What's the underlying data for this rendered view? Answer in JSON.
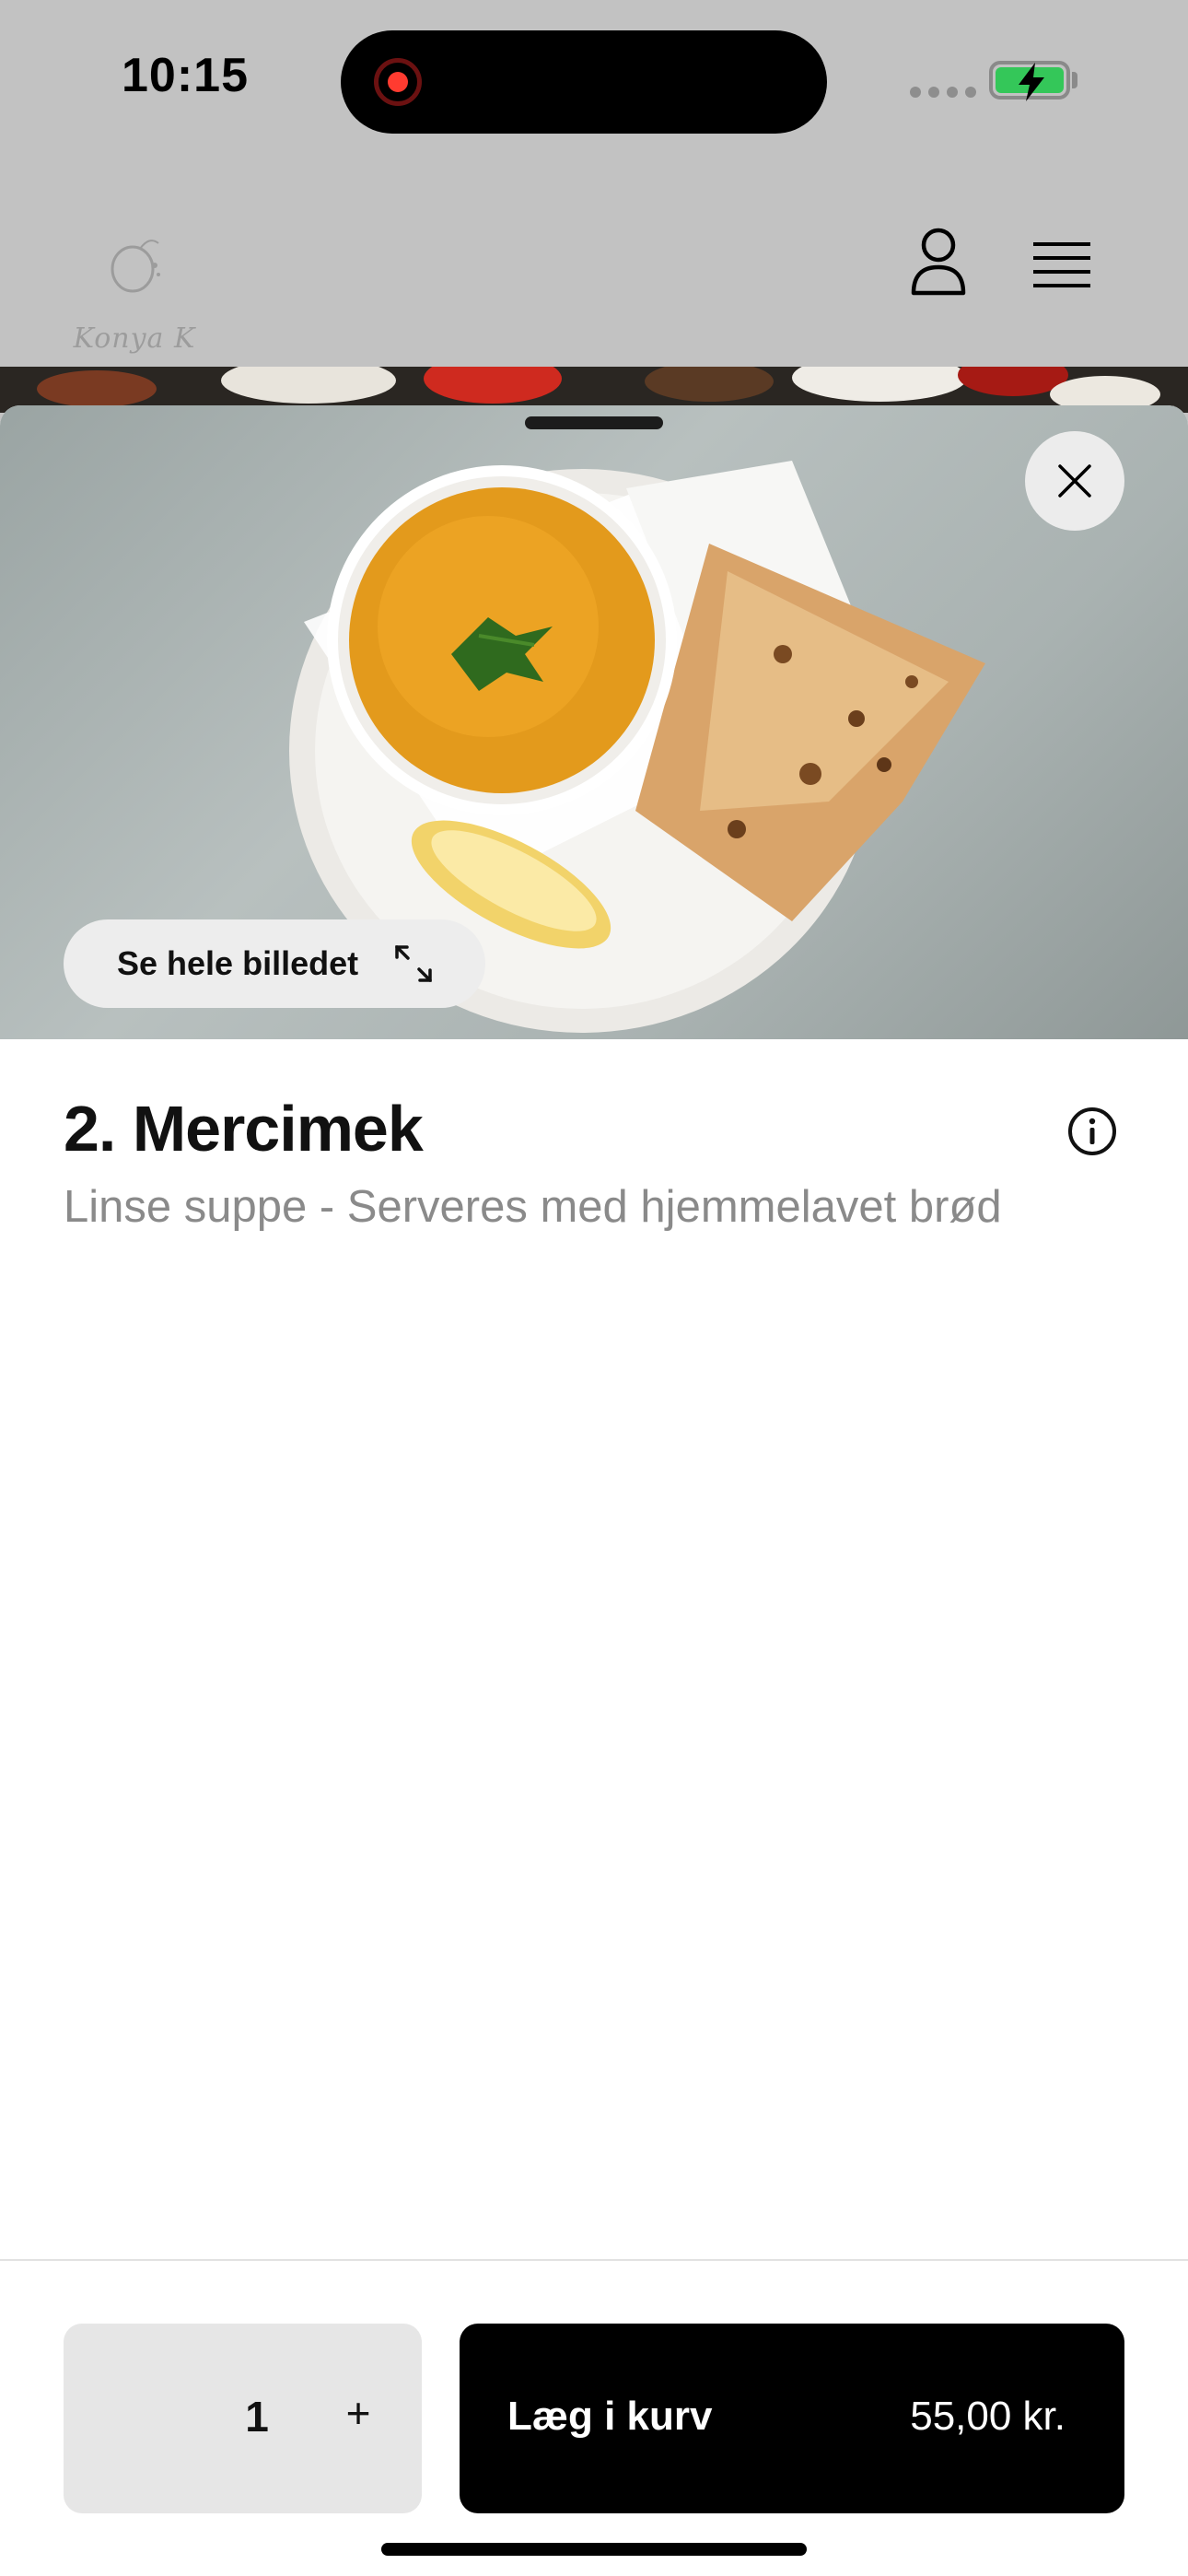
{
  "status_bar": {
    "time": "10:15"
  },
  "header": {
    "logo_text": "Konya K"
  },
  "hero": {
    "see_image_label": "Se hele billedet"
  },
  "item": {
    "title": "2. Mercimek",
    "description": "Linse suppe - Serveres med hjemmelavet brød"
  },
  "footer": {
    "quantity": "1",
    "plus_label": "+",
    "add_label": "Læg i kurv",
    "price": "55,00 kr."
  },
  "colors": {
    "accent": "#000000",
    "battery": "#34c759",
    "recording": "#ff3b30"
  },
  "icons": [
    "profile-icon",
    "menu-icon",
    "close-icon",
    "expand-icon",
    "info-icon"
  ]
}
